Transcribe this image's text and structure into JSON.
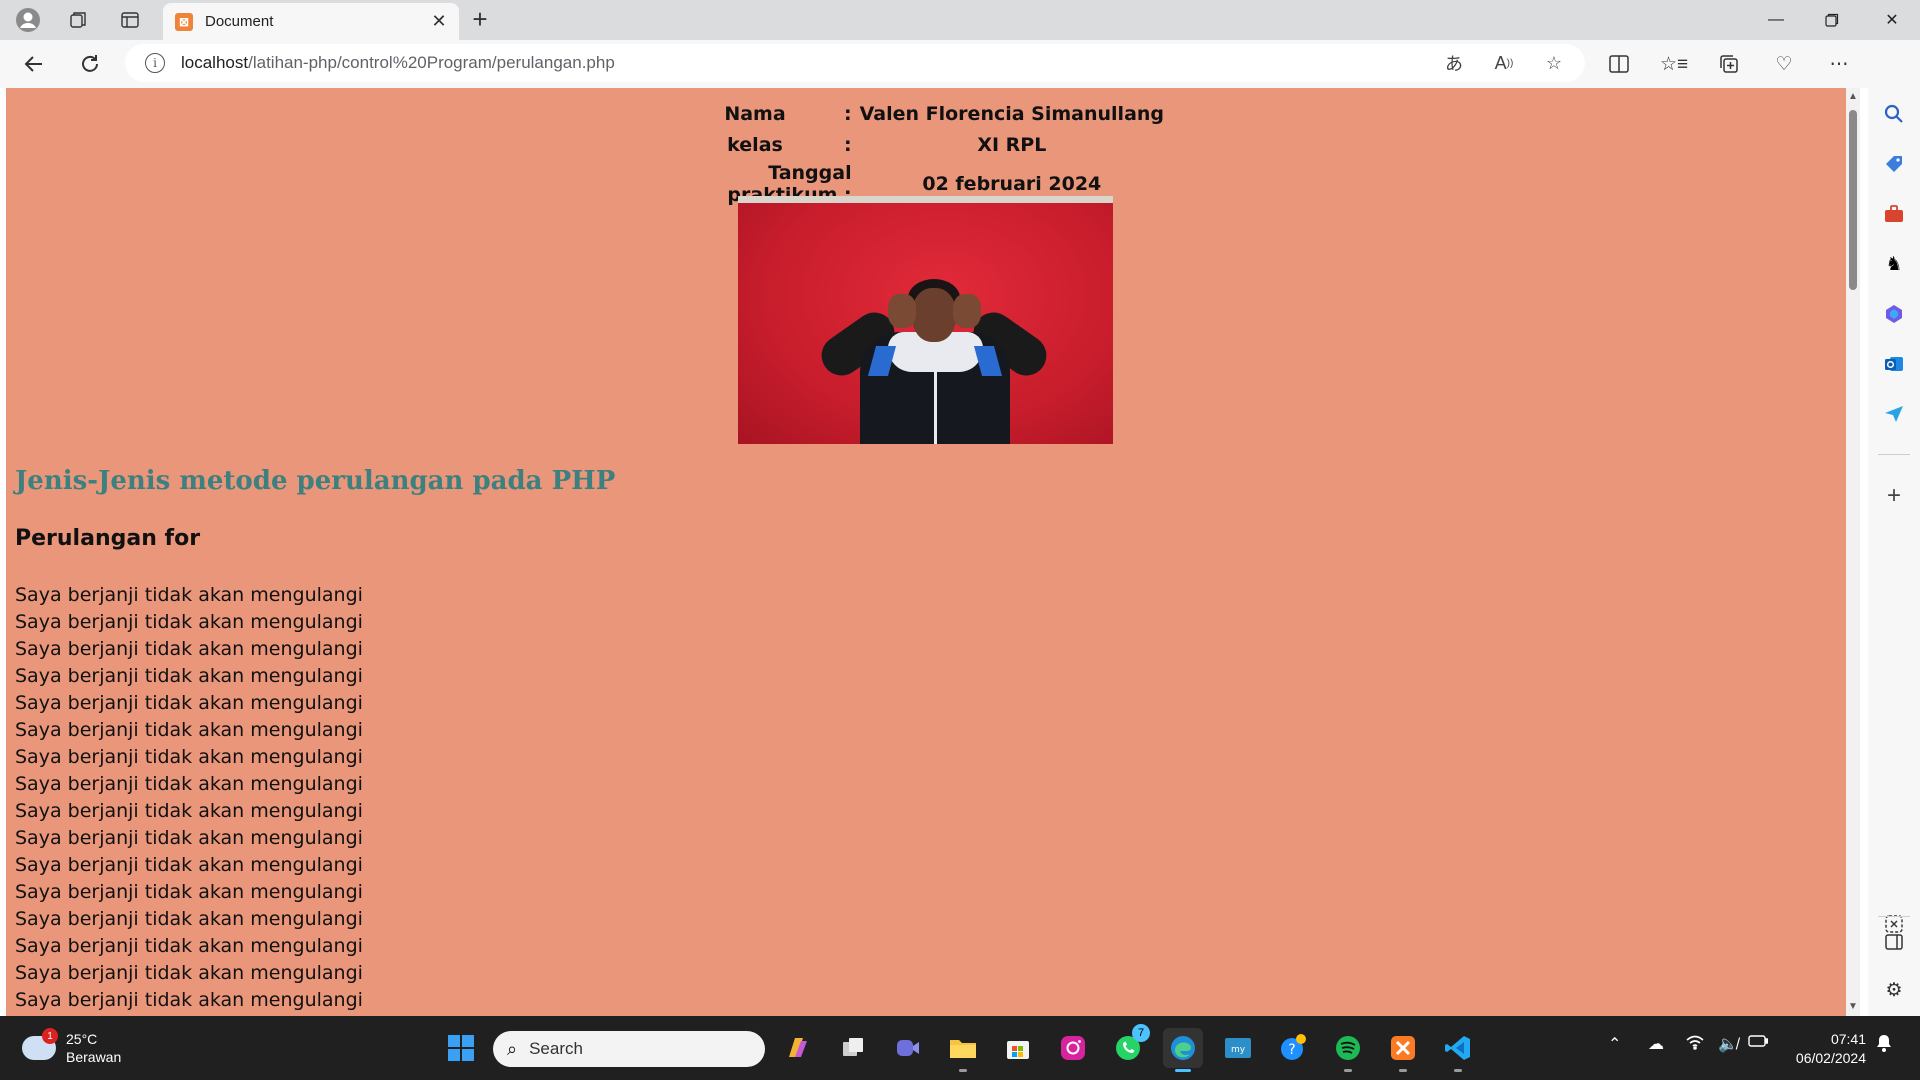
{
  "browser": {
    "tab_title": "Document",
    "url_host": "localhost",
    "url_path": "/latihan-php/control%20Program/perulangan.php"
  },
  "page": {
    "nama_label": "Nama",
    "nama_sep": ":",
    "nama_value": "Valen Florencia Simanullang",
    "kelas_label": "kelas",
    "kelas_sep": ":",
    "kelas_value": "XI RPL",
    "tanggal_label": "Tanggal praktikum :",
    "tanggal_value": "02 februari 2024",
    "heading": "Jenis-Jenis metode perulangan pada PHP",
    "subheading": "Perulangan for",
    "lines": [
      "Saya berjanji tidak akan mengulangi",
      "Saya berjanji tidak akan mengulangi",
      "Saya berjanji tidak akan mengulangi",
      "Saya berjanji tidak akan mengulangi",
      "Saya berjanji tidak akan mengulangi",
      "Saya berjanji tidak akan mengulangi",
      "Saya berjanji tidak akan mengulangi",
      "Saya berjanji tidak akan mengulangi",
      "Saya berjanji tidak akan mengulangi",
      "Saya berjanji tidak akan mengulangi",
      "Saya berjanji tidak akan mengulangi",
      "Saya berjanji tidak akan mengulangi",
      "Saya berjanji tidak akan mengulangi",
      "Saya berjanji tidak akan mengulangi",
      "Saya berjanji tidak akan mengulangi",
      "Saya berjanji tidak akan mengulangi"
    ],
    "colors": {
      "background": "#e9967a",
      "heading": "#3d8080"
    }
  },
  "taskbar": {
    "weather_temp": "25°C",
    "weather_desc": "Berawan",
    "weather_badge": "1",
    "search_placeholder": "Search",
    "whatsapp_badge": "7",
    "time": "07:41",
    "date": "06/02/2024"
  }
}
